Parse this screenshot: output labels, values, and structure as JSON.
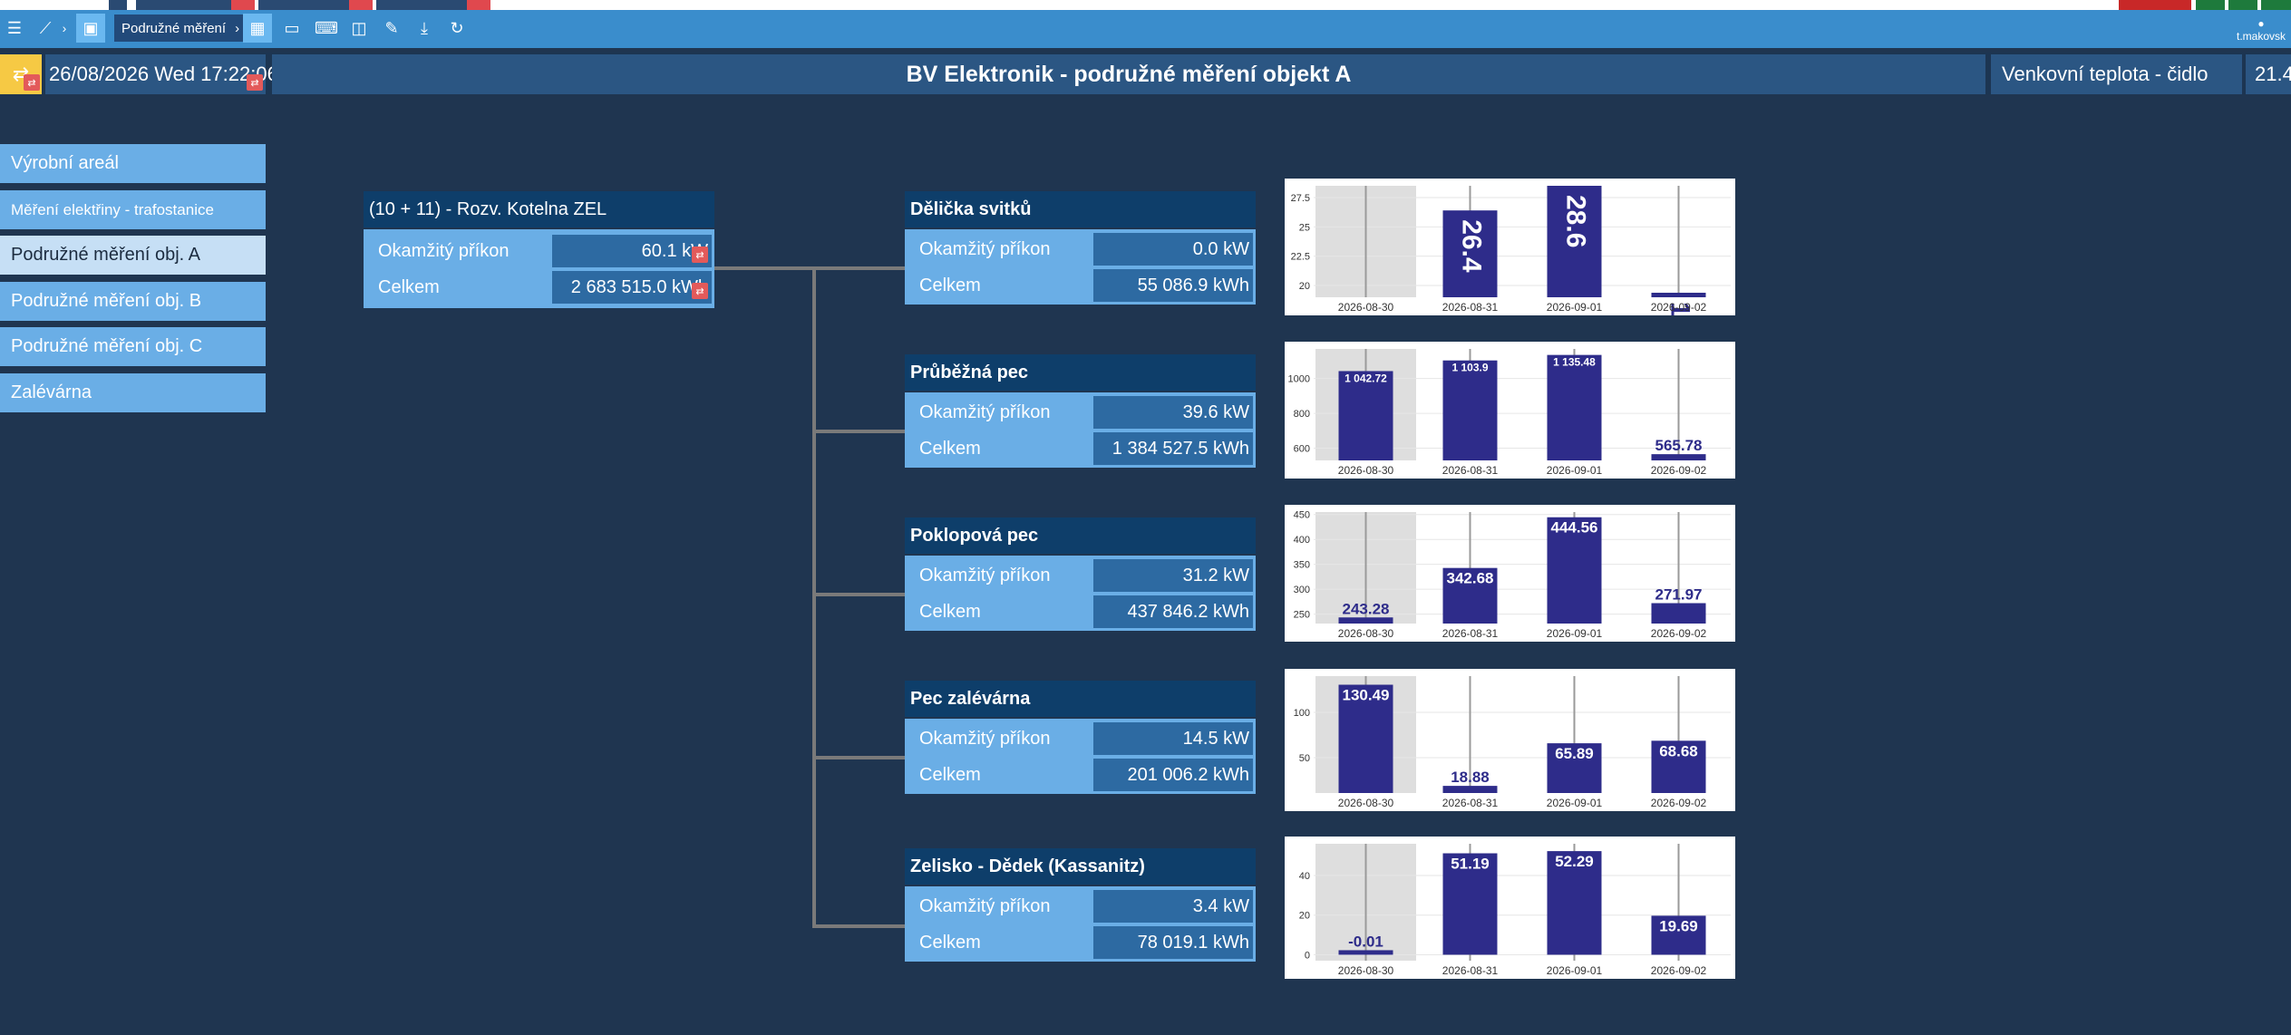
{
  "toolbar": {
    "breadcrumb": "Podružné měření",
    "user": "t.makovsk"
  },
  "header": {
    "datetime": "26/08/2026 Wed 17:22:06",
    "title": "BV Elektronik - podružné měření objekt A",
    "temp_label": "Venkovní teplota - čidlo",
    "temp_value": "21.4"
  },
  "sidebar": {
    "items": [
      {
        "label": "Výrobní areál"
      },
      {
        "label": "Měření elektřiny - trafostanice"
      },
      {
        "label": "Podružné měření obj. A"
      },
      {
        "label": "Podružné měření obj. B"
      },
      {
        "label": "Podružné měření obj. C"
      },
      {
        "label": "Zalévárna"
      }
    ]
  },
  "main_meter": {
    "title": "(10 + 11) - Rozv. Kotelna ZEL",
    "power_label": "Okamžitý příkon",
    "power_value": "60.1 kW",
    "total_label": "Celkem",
    "total_value": "2 683 515.0 kWh"
  },
  "meters": [
    {
      "title": "Dělička svitků",
      "power_label": "Okamžitý příkon",
      "power_value": "0.0 kW",
      "total_label": "Celkem",
      "total_value": "55 086.9 kWh"
    },
    {
      "title": "Průběžná pec",
      "power_label": "Okamžitý příkon",
      "power_value": "39.6 kW",
      "total_label": "Celkem",
      "total_value": "1 384 527.5 kWh"
    },
    {
      "title": "Poklopová pec",
      "power_label": "Okamžitý příkon",
      "power_value": "31.2 kW",
      "total_label": "Celkem",
      "total_value": "437 846.2 kWh"
    },
    {
      "title": "Pec zalévárna",
      "power_label": "Okamžitý příkon",
      "power_value": "14.5 kW",
      "total_label": "Celkem",
      "total_value": "201 006.2 kWh"
    },
    {
      "title": "Zelisko - Dědek (Kassanitz)",
      "power_label": "Okamžitý příkon",
      "power_value": "3.4 kW",
      "total_label": "Celkem",
      "total_value": "78 019.1 kWh"
    }
  ],
  "colors": {
    "bar": "#2e2c8a",
    "highlight": "#dedede",
    "accent": "#6aaee6"
  },
  "chart_data": [
    {
      "type": "bar",
      "categories": [
        "2026-08-30",
        "2026-08-31",
        "2026-09-01",
        "2026-09-02"
      ],
      "values": [
        null,
        26.4,
        28.6,
        18.9
      ],
      "labels": [
        "",
        "26.4",
        "28.6",
        "18.9"
      ],
      "label_rotate": true,
      "ylim": [
        19,
        28.5
      ],
      "yticks": [
        20.0,
        22.5,
        25.0,
        27.5
      ],
      "highlight_index": 0
    },
    {
      "type": "bar",
      "categories": [
        "2026-08-30",
        "2026-08-31",
        "2026-09-01",
        "2026-09-02"
      ],
      "values": [
        1042.72,
        1103.9,
        1135.48,
        565.78
      ],
      "labels": [
        "1 042.72",
        "1 103.9",
        "1 135.48",
        "565.78"
      ],
      "ylim": [
        530,
        1170
      ],
      "yticks": [
        600,
        800,
        1000
      ],
      "highlight_index": 0
    },
    {
      "type": "bar",
      "categories": [
        "2026-08-30",
        "2026-08-31",
        "2026-09-01",
        "2026-09-02"
      ],
      "values": [
        243.28,
        342.68,
        444.56,
        271.97
      ],
      "labels": [
        "243.28",
        "342.68",
        "444.56",
        "271.97"
      ],
      "ylim": [
        231,
        455
      ],
      "yticks": [
        250,
        300,
        350,
        400,
        450
      ],
      "highlight_index": 0
    },
    {
      "type": "bar",
      "categories": [
        "2026-08-30",
        "2026-08-31",
        "2026-09-01",
        "2026-09-02"
      ],
      "values": [
        130.49,
        18.88,
        65.89,
        68.68
      ],
      "labels": [
        "130.49",
        "18.88",
        "65.89",
        "68.68"
      ],
      "ylim": [
        11,
        140
      ],
      "yticks": [
        50,
        100
      ],
      "highlight_index": 0
    },
    {
      "type": "bar",
      "categories": [
        "2026-08-30",
        "2026-08-31",
        "2026-09-01",
        "2026-09-02"
      ],
      "values": [
        -0.01,
        51.19,
        52.29,
        19.69
      ],
      "labels": [
        "-0.01",
        "51.19",
        "52.29",
        "19.69"
      ],
      "ylim": [
        -3,
        56
      ],
      "yticks": [
        0,
        20,
        40
      ],
      "highlight_index": 0
    }
  ]
}
